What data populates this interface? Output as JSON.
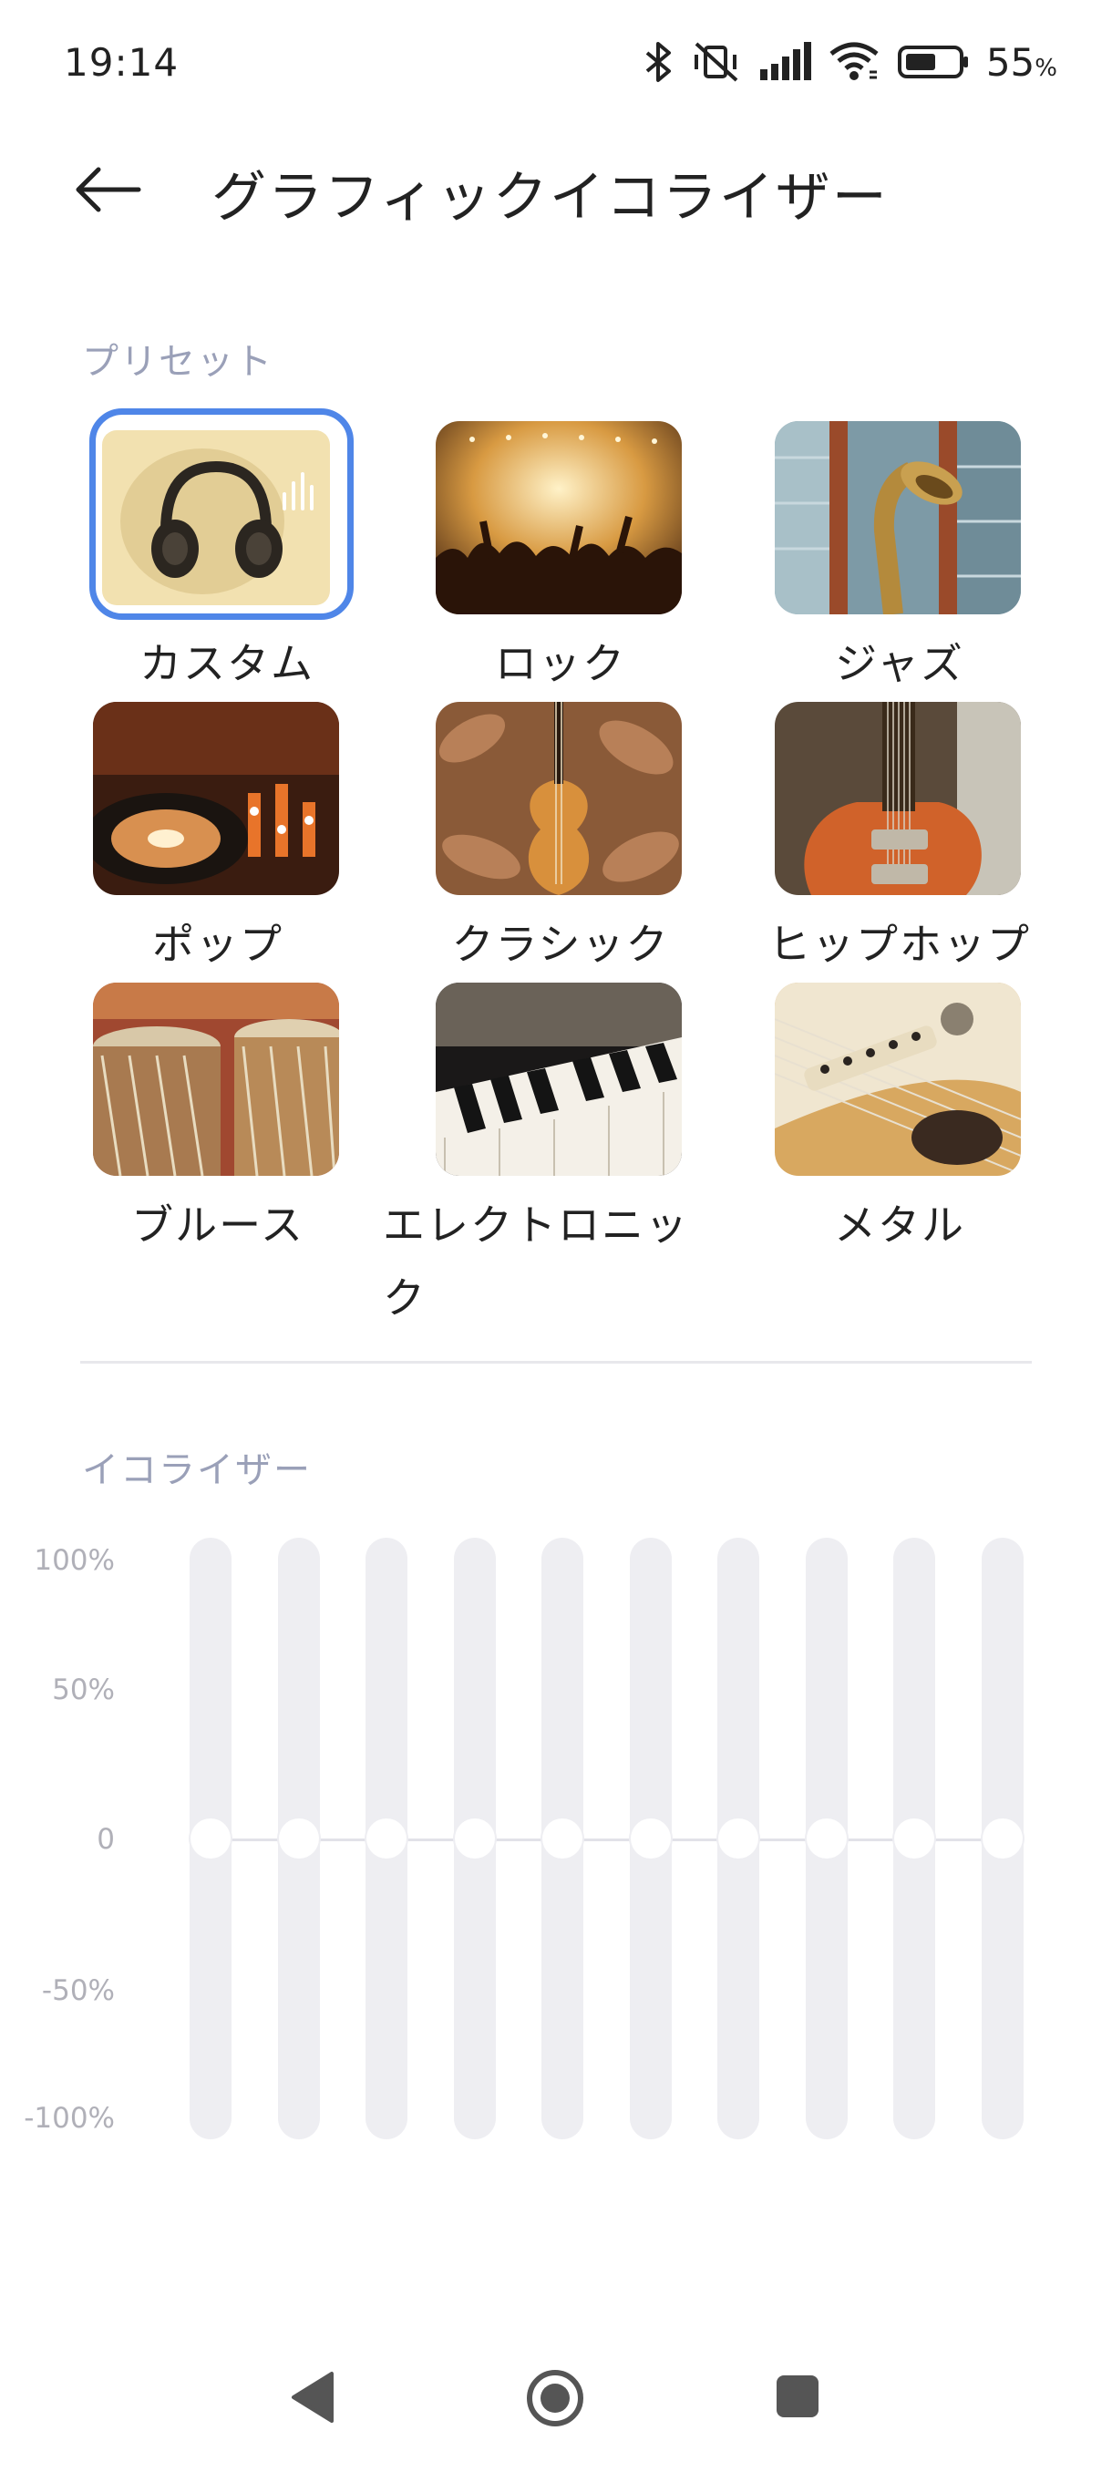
{
  "status_bar": {
    "time": "19:14",
    "battery_percent": "55",
    "battery_unit": "%",
    "icons": [
      "bluetooth-icon",
      "vibrate-off-icon",
      "signal-icon",
      "wifi-icon",
      "battery-icon"
    ]
  },
  "header": {
    "title": "グラフィックイコライザー",
    "back_icon": "arrow-left-icon"
  },
  "presets": {
    "heading": "プリセット",
    "items": [
      {
        "label": "カスタム",
        "selected": true
      },
      {
        "label": "ロック",
        "selected": false
      },
      {
        "label": "ジャズ",
        "selected": false
      },
      {
        "label": "ポップ",
        "selected": false
      },
      {
        "label": "クラシック",
        "selected": false
      },
      {
        "label": "ヒップホップ",
        "selected": false
      },
      {
        "label": "ブルース",
        "selected": false
      },
      {
        "label": "エレクトロニック",
        "selected": false
      },
      {
        "label": "メタル",
        "selected": false
      }
    ]
  },
  "equalizer": {
    "heading": "イコライザー",
    "scale_labels": [
      "100%",
      "50%",
      "0",
      "-50%",
      "-100%"
    ],
    "band_values": [
      0,
      0,
      0,
      0,
      0,
      0,
      0,
      0,
      0,
      0
    ]
  },
  "nav_bar": {
    "buttons": [
      "back-triangle-icon",
      "home-circle-icon",
      "recents-square-icon"
    ]
  },
  "colors": {
    "accent": "#4f86e8",
    "heading": "#9aa0b8",
    "track": "#eeeef2"
  }
}
